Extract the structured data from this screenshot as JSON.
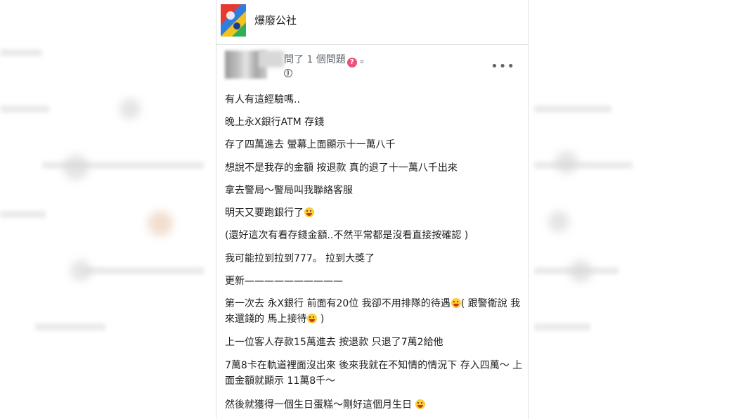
{
  "group": {
    "name": "爆廢公社"
  },
  "post": {
    "asked_label": "問了 1 個問題",
    "asked_suffix": "。",
    "more_label": "•••",
    "lines": [
      "有人有這經驗嗎..",
      "晚上永X銀行ATM 存錢",
      "存了四萬進去  螢幕上面顯示十一萬八千",
      "想說不是我存的金額 按退款 真的退了十一萬八千出來",
      "拿去警局～警局叫我聯絡客服",
      "明天又要跑銀行了",
      "(還好這次有看存錢金額..不然平常都是沒看直接按確認 )",
      "我可能拉到拉到777。 拉到大獎了",
      "更新——————————",
      "第一次去 永X銀行  前面有20位 我卻不用排隊的待遇",
      "( 跟警衛說 我",
      "來還錢的 馬上接待",
      " )",
      "上一位客人存款15萬進去 按退款  只退了7萬2給他",
      "7萬8卡在軌道裡面沒出來    後來我就在不知情的情況下 存入四萬～ 上",
      "面金額就顯示 11萬8千～",
      "然後就獲得一個生日蛋糕～剛好這個月生日"
    ]
  },
  "icons": {
    "question": "question-badge-icon",
    "globe": "globe-icon",
    "emoji": "laughing-emoji-icon"
  },
  "colors": {
    "accent": "#e9537a",
    "text": "#1c1e21",
    "muted": "#606770"
  }
}
